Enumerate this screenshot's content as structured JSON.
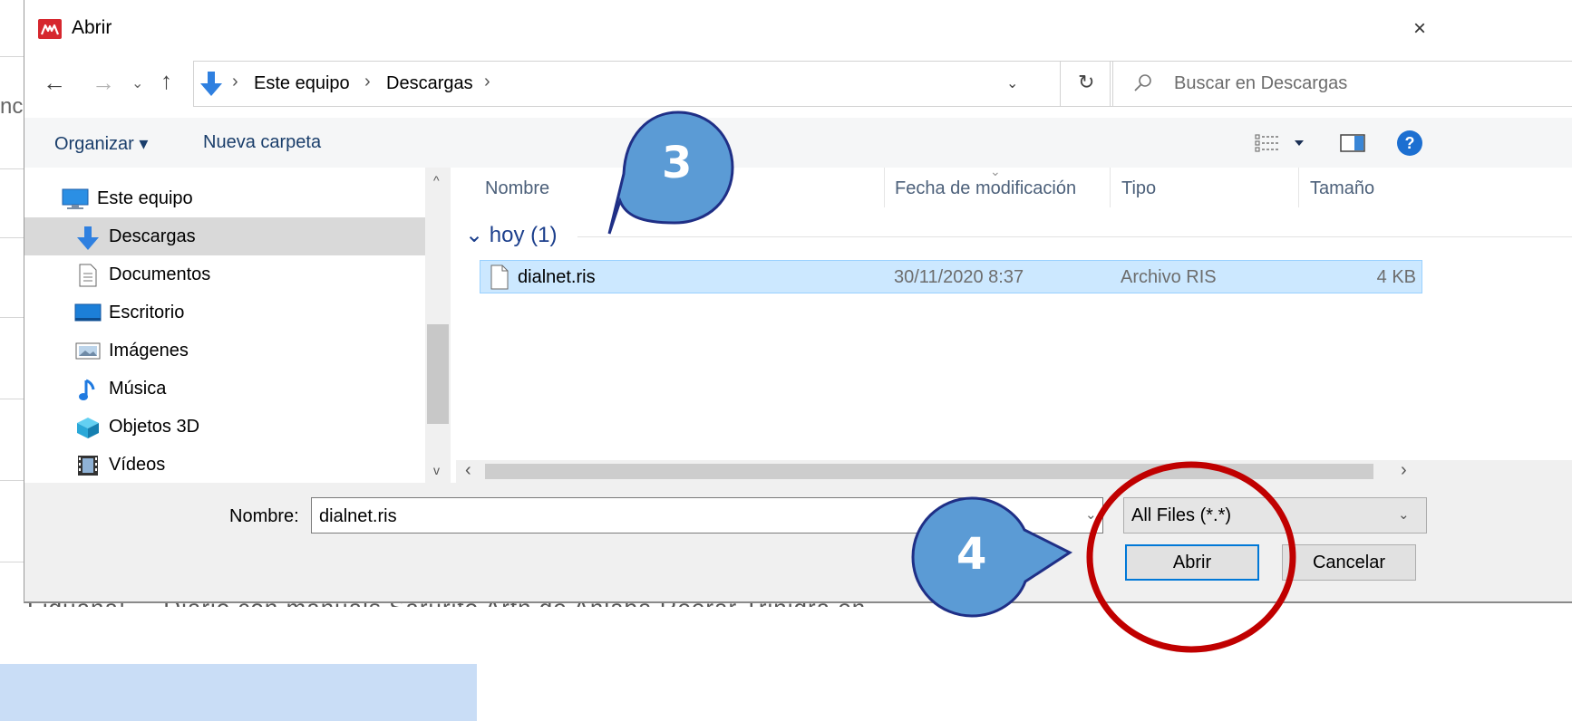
{
  "background": {
    "fragment": "nc",
    "bottom_text": "Fiduana!        ...              Diario con manuals Sarurito  Artn de Anlaba  Reerar Trinidra en"
  },
  "dialog": {
    "title": "Abrir",
    "close_glyph": "×"
  },
  "nav": {
    "back_glyph": "←",
    "forward_glyph": "→",
    "recent_glyph": "⌄",
    "up_glyph": "↑",
    "breadcrumbs": [
      "Este equipo",
      "Descargas"
    ],
    "crumb_sep": "›",
    "dropdown_glyph": "⌄",
    "refresh_glyph": "↻"
  },
  "search": {
    "placeholder": "Buscar en Descargas"
  },
  "toolbar": {
    "organize_label": "Organizar ▾",
    "new_folder_label": "Nueva carpeta",
    "help_glyph": "?"
  },
  "sidebar": {
    "items": [
      {
        "label": "Este equipo",
        "icon": "computer-icon"
      },
      {
        "label": "Descargas",
        "icon": "download-icon",
        "selected": true
      },
      {
        "label": "Documentos",
        "icon": "document-icon"
      },
      {
        "label": "Escritorio",
        "icon": "desktop-icon"
      },
      {
        "label": "Imágenes",
        "icon": "pictures-icon"
      },
      {
        "label": "Música",
        "icon": "music-icon"
      },
      {
        "label": "Objetos 3D",
        "icon": "3d-objects-icon"
      },
      {
        "label": "Vídeos",
        "icon": "videos-icon"
      }
    ],
    "scroll_up_glyph": "^",
    "scroll_down_glyph": "v"
  },
  "files": {
    "columns": {
      "name": "Nombre",
      "modified": "Fecha de modificación",
      "type": "Tipo",
      "size": "Tamaño"
    },
    "sort_glyph": "⌄",
    "group_label": "⌄ hoy (1)",
    "rows": [
      {
        "name": "dialnet.ris",
        "modified": "30/11/2020 8:37",
        "type": "Archivo RIS",
        "size": "4 KB"
      }
    ],
    "hscroll_left": "‹",
    "hscroll_right": "›"
  },
  "footer": {
    "filename_label": "Nombre:",
    "filename_value": "dialnet.ris",
    "filter_value": "All Files (*.*)",
    "dropdown_glyph": "⌄",
    "open_label": "Abrir",
    "cancel_label": "Cancelar"
  },
  "annotations": {
    "step3": "3",
    "step4": "4",
    "callout_color": "#5b9bd5",
    "callout_border": "#1f2f86",
    "circle_color": "#c00000"
  }
}
